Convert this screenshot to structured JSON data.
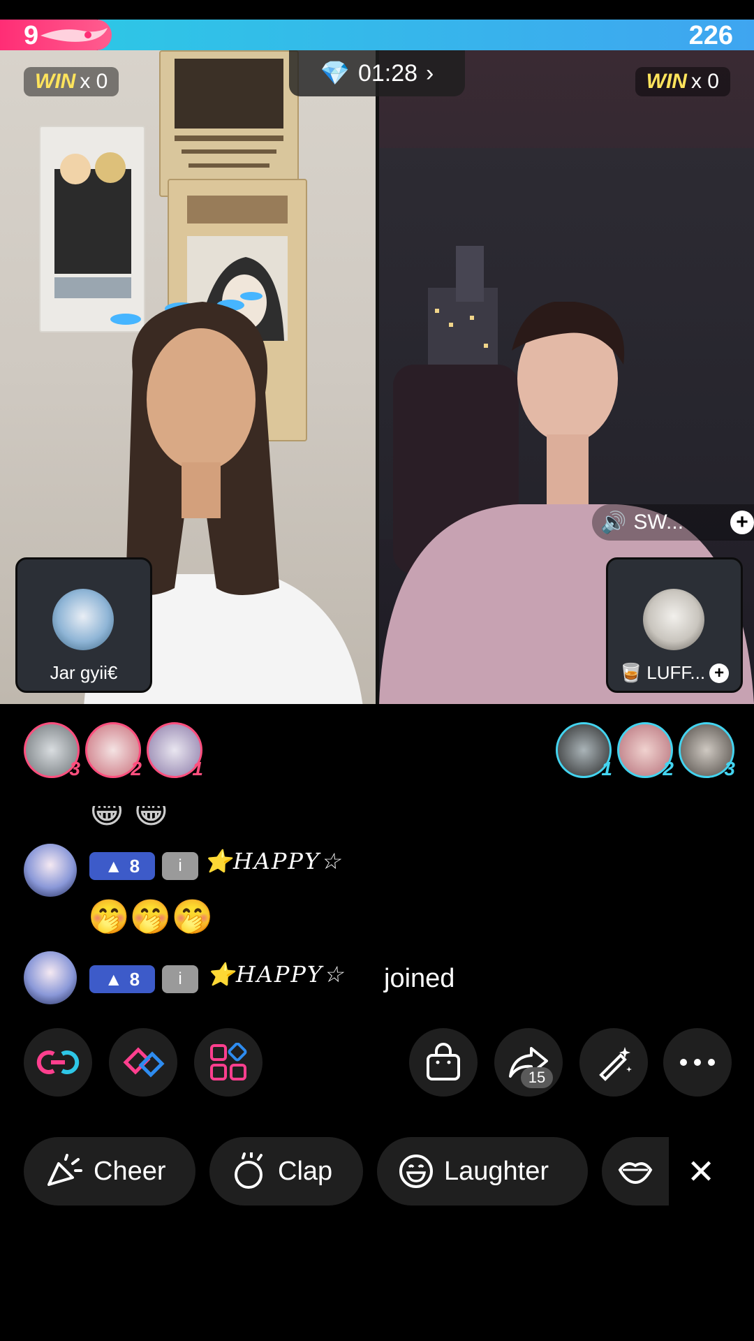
{
  "battle": {
    "left_score": "9",
    "right_score": "226",
    "timer": "01:28",
    "left_win": {
      "label": "WIN",
      "count": "x 0"
    },
    "right_win": {
      "label": "WIN",
      "count": "x 0"
    }
  },
  "left_host": {
    "guest_name": "Jar gyii€",
    "supporters": [
      {
        "rank": "3"
      },
      {
        "rank": "2"
      },
      {
        "rank": "1"
      }
    ]
  },
  "right_host": {
    "sound_label": "SW...",
    "guest_name": "LUFF...",
    "supporters": [
      {
        "rank": "1"
      },
      {
        "rank": "2"
      },
      {
        "rank": "3"
      }
    ]
  },
  "chat": [
    {
      "level": "8",
      "badge": "i",
      "user": "HAPPY",
      "message": "🤭🤭🤭"
    },
    {
      "level": "8",
      "badge": "i",
      "user": "HAPPY",
      "message": "joined"
    }
  ],
  "actions": {
    "share_count": "15",
    "icons": [
      "link-icon",
      "battle-gloves-icon",
      "apps-grid-icon",
      "shopping-bag-icon",
      "share-icon",
      "magic-wand-icon",
      "more-icon"
    ]
  },
  "reactions": [
    {
      "label": "Cheer",
      "icon": "cheer-icon"
    },
    {
      "label": "Clap",
      "icon": "clap-icon"
    },
    {
      "label": "Laughter",
      "icon": "laughter-icon"
    },
    {
      "label": "",
      "icon": "lips-icon"
    }
  ],
  "colors": {
    "left_team": "#ff2d75",
    "right_team": "#2ec6e6",
    "level_badge": "#3d5bc9"
  }
}
